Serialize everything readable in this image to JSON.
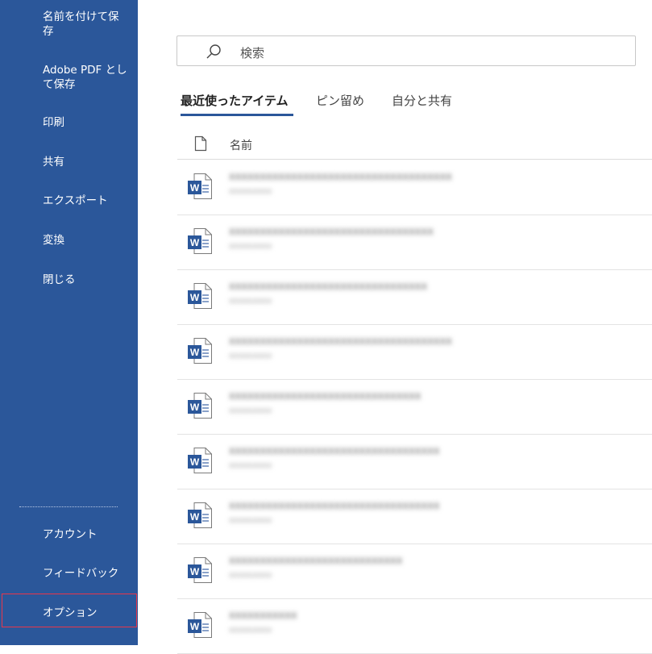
{
  "sidebar": {
    "items": [
      {
        "label_lines": [
          "名前を付けて保",
          "存"
        ]
      },
      {
        "label_lines": [
          "Adobe PDF とし",
          "て保存"
        ]
      },
      {
        "label_lines": [
          "印刷"
        ]
      },
      {
        "label_lines": [
          "共有"
        ]
      },
      {
        "label_lines": [
          "エクスポート"
        ]
      },
      {
        "label_lines": [
          "変換"
        ]
      },
      {
        "label_lines": [
          "閉じる"
        ]
      }
    ],
    "bottom_items": [
      {
        "label": "アカウント"
      },
      {
        "label": "フィードバック"
      },
      {
        "label": "オプション",
        "highlighted": true
      }
    ],
    "colors": {
      "background": "#2b579a",
      "highlight_border": "#e8364a"
    }
  },
  "search": {
    "placeholder": "検索",
    "icon": "search-icon"
  },
  "tabs": [
    {
      "label": "最近使ったアイテム",
      "active": true
    },
    {
      "label": "ピン留め",
      "active": false
    },
    {
      "label": "自分と共有",
      "active": false
    }
  ],
  "list": {
    "column_name": "名前",
    "rows": [
      {
        "name": "xxxxxxxxxxxxxxxxxxxxxxxxxxxxxxxxxxxx",
        "path": "xxxxxxxxx"
      },
      {
        "name": "xxxxxxxxxxxxxxxxxxxxxxxxxxxxxxxxx",
        "path": "xxxxxxxxx"
      },
      {
        "name": "xxxxxxxxxxxxxxxxxxxxxxxxxxxxxxxx",
        "path": "xxxxxxxxx"
      },
      {
        "name": "xxxxxxxxxxxxxxxxxxxxxxxxxxxxxxxxxxxx",
        "path": "xxxxxxxxx"
      },
      {
        "name": "xxxxxxxxxxxxxxxxxxxxxxxxxxxxxxx",
        "path": "xxxxxxxxx"
      },
      {
        "name": "xxxxxxxxxxxxxxxxxxxxxxxxxxxxxxxxxx",
        "path": "xxxxxxxxx"
      },
      {
        "name": "xxxxxxxxxxxxxxxxxxxxxxxxxxxxxxxxxx",
        "path": "xxxxxxxxx"
      },
      {
        "name": "xxxxxxxxxxxxxxxxxxxxxxxxxxxx",
        "path": "xxxxxxxxx"
      },
      {
        "name": "xxxxxxxxxxx",
        "path": "xxxxxxxxx"
      }
    ]
  }
}
